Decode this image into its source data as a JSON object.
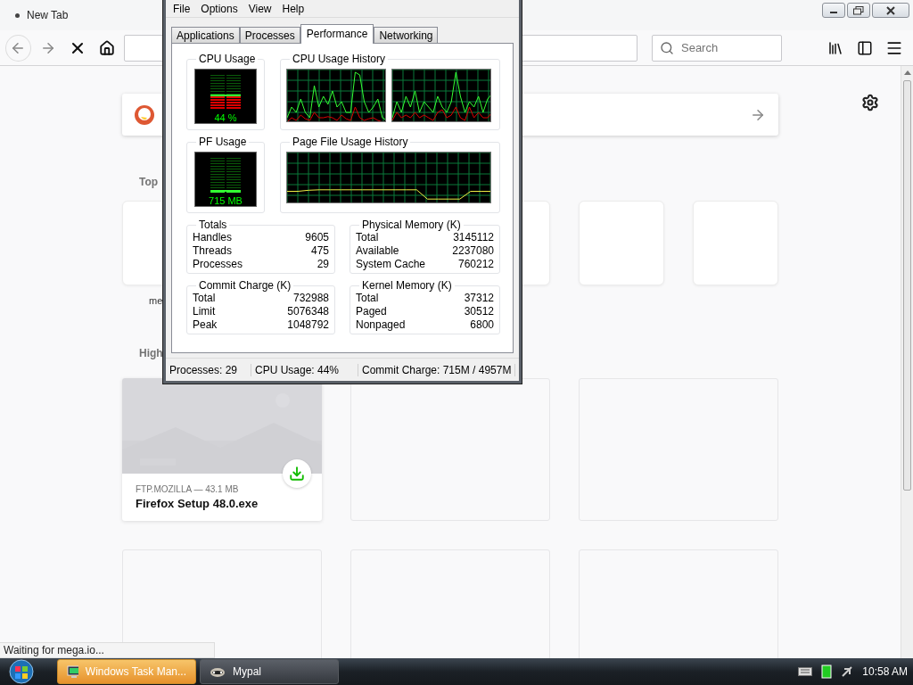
{
  "browser": {
    "tab": {
      "title": "New Tab"
    },
    "search": {
      "placeholder": "Search"
    },
    "top_sites": {
      "heading": "Top",
      "tiles": [
        {
          "kind": "site",
          "label": "me"
        },
        {
          "kind": "empty"
        },
        {
          "kind": "empty"
        },
        {
          "kind": "empty"
        }
      ]
    },
    "highlights": {
      "heading": "High",
      "cards": [
        {
          "kind": "download",
          "source": "FTP.MOZILLA — 43.1 MB",
          "title": "Firefox Setup 48.0.exe"
        },
        {
          "kind": "empty"
        },
        {
          "kind": "empty"
        },
        {
          "kind": "empty"
        },
        {
          "kind": "empty"
        },
        {
          "kind": "empty"
        }
      ]
    },
    "status": "Waiting for mega.io..."
  },
  "task_manager": {
    "menu": [
      "File",
      "Options",
      "View",
      "Help"
    ],
    "tabs": [
      {
        "label": "Applications",
        "selected": false
      },
      {
        "label": "Processes",
        "selected": false
      },
      {
        "label": "Performance",
        "selected": true
      },
      {
        "label": "Networking",
        "selected": false
      }
    ],
    "cpu_usage": {
      "title": "CPU Usage",
      "reading": "44 %",
      "level": 0.44
    },
    "cpu_history": {
      "title": "CPU Usage History"
    },
    "pf_usage": {
      "title": "PF Usage",
      "reading": "715 MB",
      "level": 0.08
    },
    "pf_history": {
      "title": "Page File Usage History"
    },
    "groups": [
      {
        "title": "Totals",
        "rows": [
          {
            "label": "Handles",
            "value": "9605"
          },
          {
            "label": "Threads",
            "value": "475"
          },
          {
            "label": "Processes",
            "value": "29"
          }
        ]
      },
      {
        "title": "Physical Memory (K)",
        "rows": [
          {
            "label": "Total",
            "value": "3145112"
          },
          {
            "label": "Available",
            "value": "2237080"
          },
          {
            "label": "System Cache",
            "value": "760212"
          }
        ]
      },
      {
        "title": "Commit Charge (K)",
        "rows": [
          {
            "label": "Total",
            "value": "732988"
          },
          {
            "label": "Limit",
            "value": "5076348"
          },
          {
            "label": "Peak",
            "value": "1048792"
          }
        ]
      },
      {
        "title": "Kernel Memory (K)",
        "rows": [
          {
            "label": "Total",
            "value": "37312"
          },
          {
            "label": "Paged",
            "value": "30512"
          },
          {
            "label": "Nonpaged",
            "value": "6800"
          }
        ]
      }
    ],
    "status_bar": [
      "Processes: 29",
      "CPU Usage: 44%",
      "Commit Charge: 715M / 4957M"
    ]
  },
  "taskbar": {
    "buttons": [
      {
        "label": "Windows Task Man...",
        "selected": true,
        "kind": "taskmgr"
      },
      {
        "label": "Mypal",
        "selected": false,
        "kind": "browser"
      }
    ],
    "clock": "10:58 AM"
  }
}
